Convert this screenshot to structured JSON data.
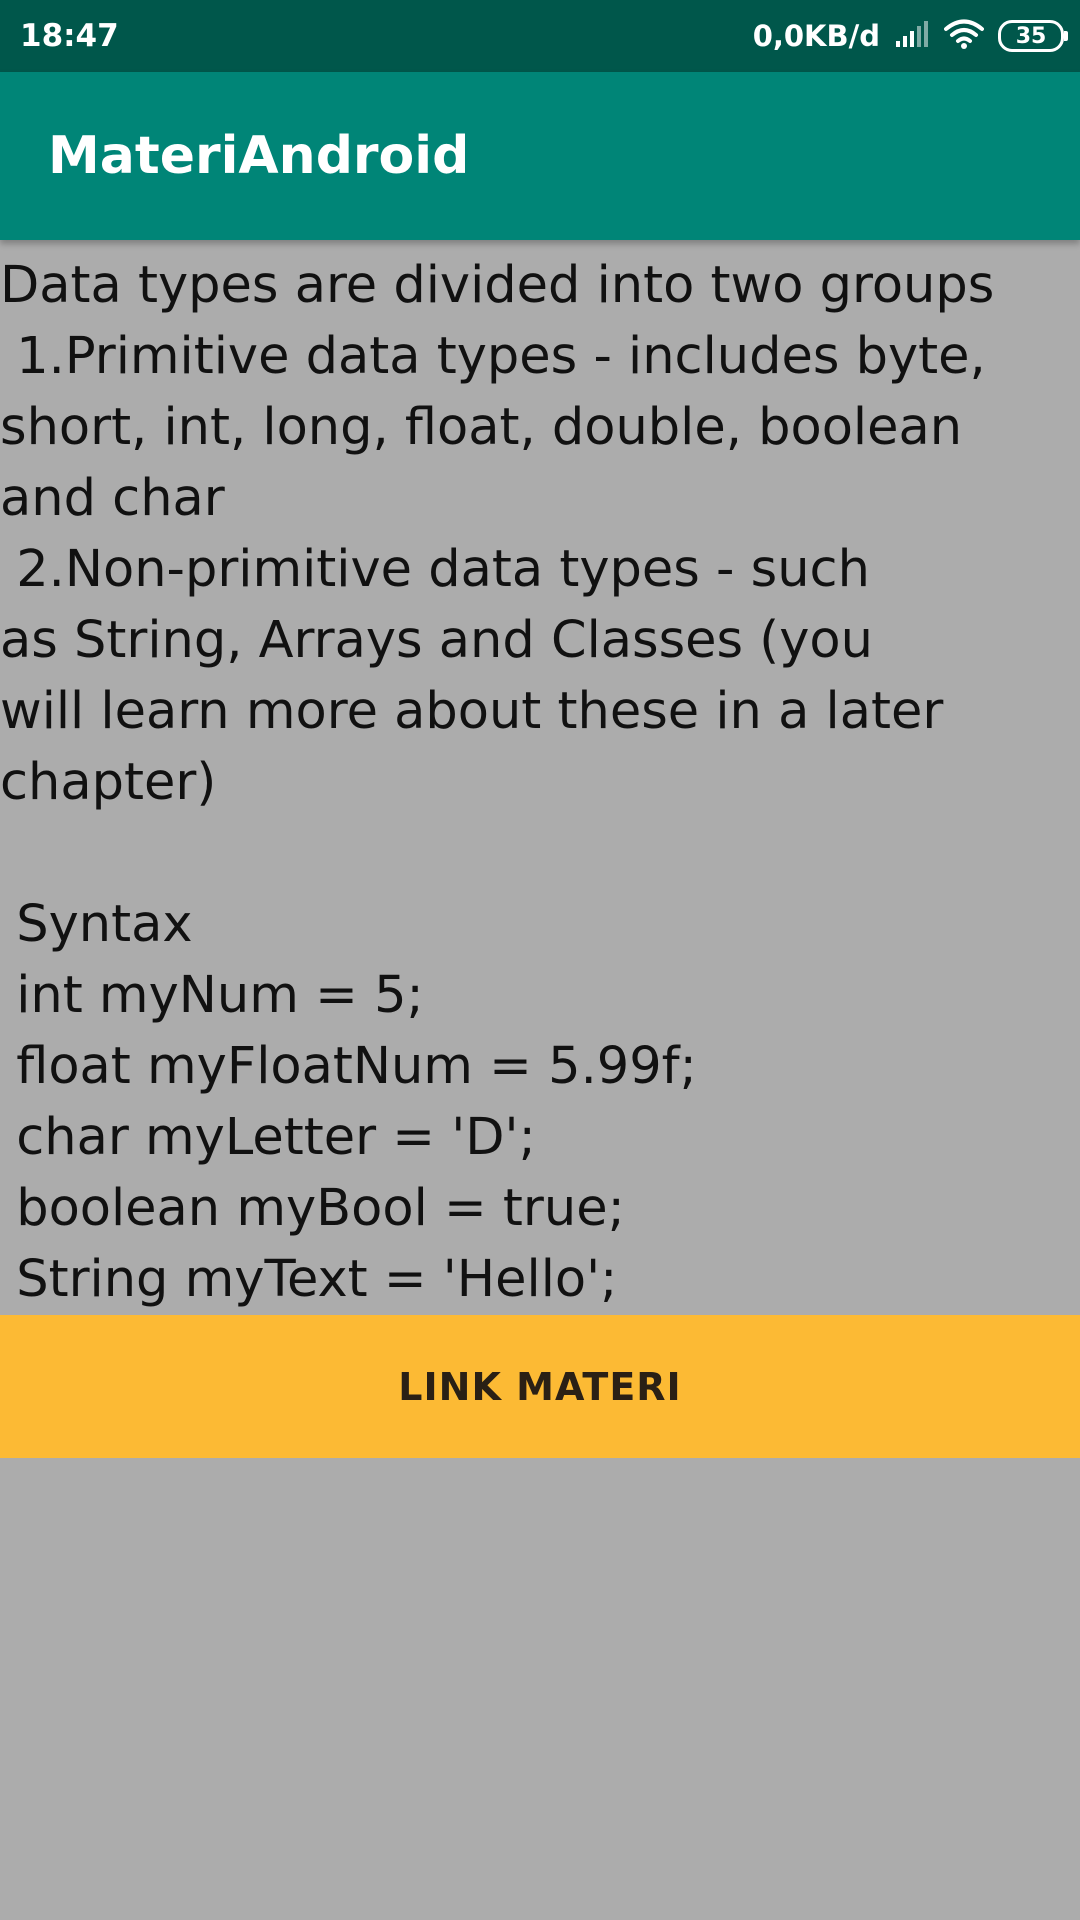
{
  "status_bar": {
    "time": "18:47",
    "net_speed": "0,0KB/d",
    "battery": "35",
    "icons": [
      "signal-icon",
      "wifi-icon",
      "battery-icon"
    ]
  },
  "app_bar": {
    "title": "MateriAndroid",
    "color": "#008577"
  },
  "content": {
    "lines": [
      "Data types are divided into two groups",
      " 1.Primitive data types - includes byte,",
      "short, int, long, float, double, boolean",
      "and char",
      " 2.Non-primitive data types - such",
      "as String, Arrays and Classes (you",
      "will learn more about these in a later",
      "chapter)",
      "",
      " Syntax",
      " int myNum = 5;",
      " float myFloatNum = 5.99f;",
      " char myLetter = 'D';",
      " boolean myBool = true;",
      " String myText = 'Hello';"
    ]
  },
  "button": {
    "label": "LINK MATERI",
    "color": "#fcba34"
  },
  "background_color": "#acacac"
}
